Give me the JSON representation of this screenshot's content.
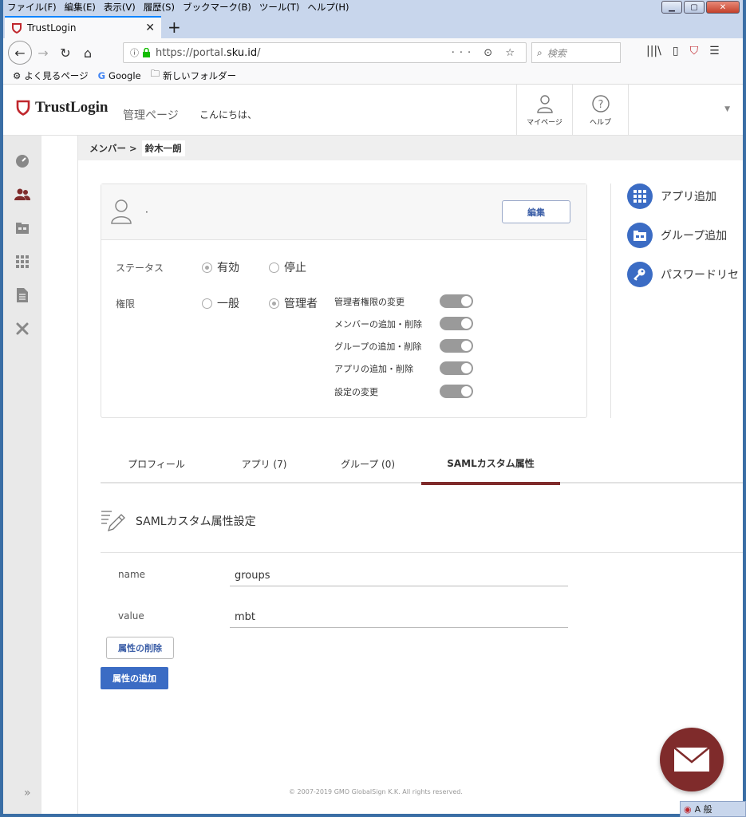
{
  "browser": {
    "menu": [
      "ファイル(F)",
      "編集(E)",
      "表示(V)",
      "履歴(S)",
      "ブックマーク(B)",
      "ツール(T)",
      "ヘルプ(H)"
    ],
    "tab_title": "TrustLogin",
    "url_prefix": "https://portal.",
    "url_host": "sku.id",
    "url_suffix": "/",
    "url_tools": "··· ⊙ ☆",
    "search_placeholder": "検索",
    "bookmarks": [
      "よく見るページ",
      "Google",
      "新しいフォルダー"
    ]
  },
  "header": {
    "logo_text": "TrustLogin",
    "admin_label": "管理ページ",
    "greeting": "こんにちは、",
    "mypage_label": "マイページ",
    "help_label": "ヘルプ"
  },
  "breadcrumb": {
    "parent": "メンバー >",
    "current": "鈴木一朗"
  },
  "card": {
    "name": "·",
    "edit_label": "編集",
    "status_label": "ステータス",
    "status_options": [
      "有効",
      "停止"
    ],
    "status_selected": "有効",
    "role_label": "権限",
    "role_options": [
      "一般",
      "管理者"
    ],
    "role_selected": "管理者",
    "permissions": [
      {
        "label": "管理者権限の変更",
        "enabled": true
      },
      {
        "label": "メンバーの追加・削除",
        "enabled": true
      },
      {
        "label": "グループの追加・削除",
        "enabled": true
      },
      {
        "label": "アプリの追加・削除",
        "enabled": true
      },
      {
        "label": "設定の変更",
        "enabled": true
      }
    ]
  },
  "actions": [
    "アプリ追加",
    "グループ追加",
    "パスワードリセ"
  ],
  "tabs": [
    {
      "label": "プロフィール",
      "active": false
    },
    {
      "label": "アプリ (7)",
      "active": false
    },
    {
      "label": "グループ (0)",
      "active": false
    },
    {
      "label": "SAMLカスタム属性",
      "active": true
    }
  ],
  "saml": {
    "title": "SAMLカスタム属性設定",
    "fields": [
      {
        "label": "name",
        "value": "groups"
      },
      {
        "label": "value",
        "value": "mbt"
      }
    ],
    "delete_label": "属性の削除",
    "add_label": "属性の追加"
  },
  "footer": "© 2007-2019 GMO GlobalSign K.K. All rights reserved.",
  "colors": {
    "accent_blue": "#3b6cc4",
    "brand_red": "#7f2b2b",
    "toggle_gray": "#9a9a9a"
  },
  "tray_text": "A 般"
}
